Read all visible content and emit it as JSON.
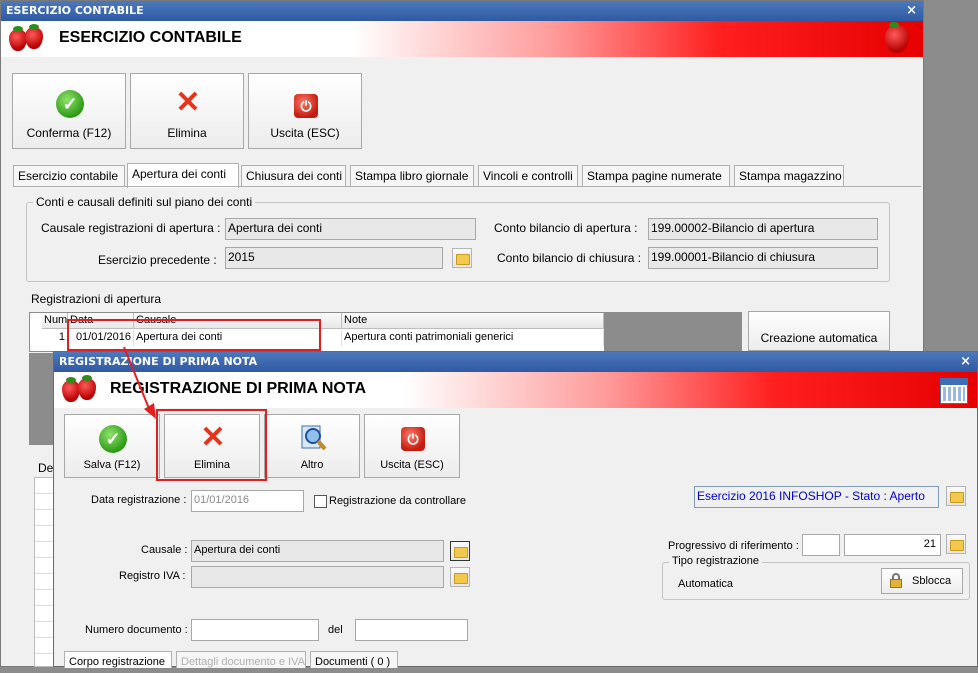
{
  "window1": {
    "title": "ESERCIZIO CONTABILE",
    "header": "ESERCIZIO CONTABILE",
    "close": "×",
    "toolbar": {
      "confirm": "Conferma (F12)",
      "delete": "Elimina",
      "exit": "Uscita (ESC)"
    },
    "tabs": [
      "Esercizio contabile",
      "Apertura dei conti",
      "Chiusura dei conti",
      "Stampa libro giornale",
      "Vincoli e controlli",
      "Stampa pagine numerate",
      "Stampa magazzino"
    ],
    "group_title": "Conti e causali definiti sul piano dei conti",
    "fields": {
      "causale_label": "Causale registrazioni di apertura :",
      "causale_value": "Apertura dei conti",
      "esercizio_label": "Esercizio precedente :",
      "esercizio_value": "2015",
      "conto_apertura_label": "Conto bilancio di apertura :",
      "conto_apertura_value": "199.00002-Bilancio di apertura",
      "conto_chiusura_label": "Conto bilancio di chiusura :",
      "conto_chiusura_value": "199.00001-Bilancio di chiusura"
    },
    "registrazioni_label": "Registrazioni di apertura",
    "grid": {
      "headers": [
        "Num",
        "Data",
        "Causale",
        "Note"
      ],
      "row": {
        "num": "1",
        "data": "01/01/2016",
        "causale": "Apertura dei conti",
        "note": "Apertura conti patrimoniali generici"
      }
    },
    "auto_button": "Creazione automatica",
    "de_label": "De"
  },
  "window2": {
    "title": "REGISTRAZIONE DI PRIMA NOTA",
    "header": "REGISTRAZIONE DI PRIMA NOTA",
    "close": "×",
    "toolbar": {
      "save": "Salva (F12)",
      "delete": "Elimina",
      "other": "Altro",
      "exit": "Uscita (ESC)"
    },
    "data_reg_label": "Data registrazione :",
    "data_reg_value": "01/01/2016",
    "check_label": "Registrazione da controllare",
    "esercizio_status": "Esercizio 2016 INFOSHOP - Stato : Aperto",
    "causale_label": "Causale :",
    "causale_value": "Apertura dei conti",
    "registro_label": "Registro IVA :",
    "registro_value": "",
    "progressivo_label": "Progressivo di riferimento :",
    "progressivo_value": "21",
    "tipo_label": "Tipo registrazione",
    "tipo_value": "Automatica",
    "sblocca": "Sblocca",
    "numero_label": "Numero documento :",
    "del_label": "del",
    "bottom_tabs": [
      "Corpo registrazione",
      "Dettagli documento e IVA",
      "Documenti ( 0 )"
    ]
  },
  "colors": {
    "titlebar": "#2f5aa3",
    "accent_red": "#e02020",
    "status_blue": "#0000cc"
  }
}
